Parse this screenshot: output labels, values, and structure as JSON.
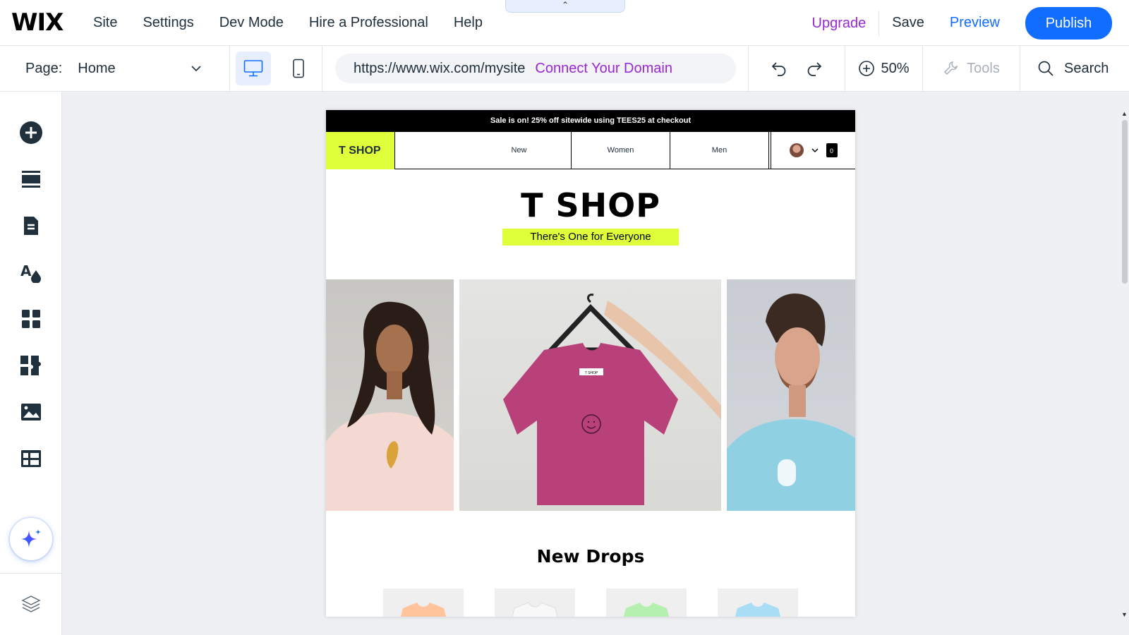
{
  "topbar": {
    "logo": "WIX",
    "menu": [
      "Site",
      "Settings",
      "Dev Mode",
      "Hire a Professional",
      "Help"
    ],
    "upgrade": "Upgrade",
    "save": "Save",
    "preview": "Preview",
    "publish": "Publish"
  },
  "subbar": {
    "page_label": "Page:",
    "page_name": "Home",
    "url": "https://www.wix.com/mysite",
    "connect_domain": "Connect Your Domain",
    "zoom": "50%",
    "tools": "Tools",
    "search": "Search"
  },
  "site": {
    "announcement": "Sale is on! 25% off sitewide using TEES25 at checkout",
    "brand": "T SHOP",
    "nav": [
      "New",
      "Women",
      "Men"
    ],
    "cart_count": "0",
    "hero_title": "T SHOP",
    "hero_subtitle": "There's One for Everyone",
    "tag_text": "T SHOP",
    "new_drops": "New Drops"
  },
  "colors": {
    "accent_blue": "#116dff",
    "upgrade_purple": "#9a27d5",
    "brand_lime": "#dfff3a"
  }
}
